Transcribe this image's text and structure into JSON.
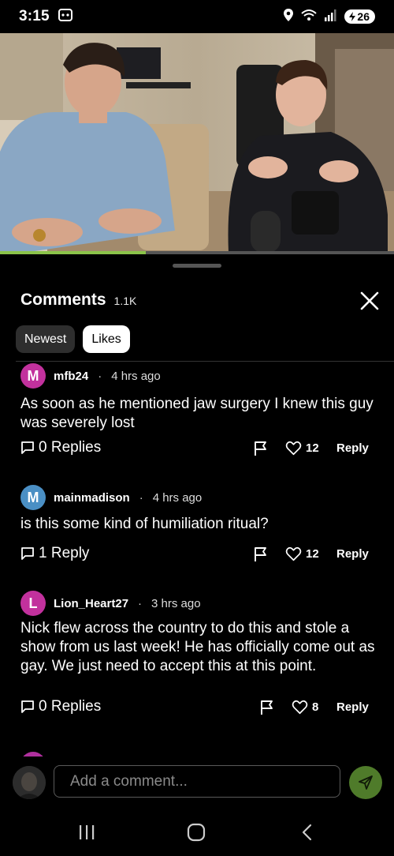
{
  "status_bar": {
    "time": "3:15",
    "battery": "26"
  },
  "video": {
    "progress": 0.37
  },
  "comments_sheet": {
    "title": "Comments",
    "count": "1.1K",
    "sort_options": [
      {
        "label": "Newest",
        "active": false
      },
      {
        "label": "Likes",
        "active": true
      }
    ],
    "comments": [
      {
        "avatar_letter": "M",
        "avatar_color": "#c2319d",
        "username": "mfb24",
        "separator": "·",
        "time": "4 hrs ago",
        "text": "As soon as he mentioned jaw surgery I knew this guy was severely lost",
        "replies": "0 Replies",
        "likes": "12",
        "reply_label": "Reply"
      },
      {
        "avatar_letter": "M",
        "avatar_color": "#4a8fc4",
        "username": "mainmadison",
        "separator": "·",
        "time": "4 hrs ago",
        "text": "is this some  kind of  humiliation ritual?",
        "replies": "1 Reply",
        "likes": "12",
        "reply_label": "Reply"
      },
      {
        "avatar_letter": "L",
        "avatar_color": "#c2319d",
        "username": "Lion_Heart27",
        "separator": "·",
        "time": "3 hrs ago",
        "text": "Nick flew across the country to do this and stole a show from us last week! He has officially come out as gay. We just need to accept this at this point.",
        "replies": "0 Replies",
        "likes": "8",
        "reply_label": "Reply"
      }
    ]
  },
  "composer": {
    "placeholder": "Add a comment..."
  },
  "colors": {
    "background": "#000000",
    "accent_green": "#8bc34a",
    "send_button": "#4f7b2a"
  },
  "icons": [
    "location-icon",
    "wifi-icon",
    "signal-icon",
    "battery-icon",
    "close-icon",
    "comment-icon",
    "flag-icon",
    "heart-icon",
    "send-icon",
    "recents-icon",
    "home-icon",
    "back-icon"
  ]
}
